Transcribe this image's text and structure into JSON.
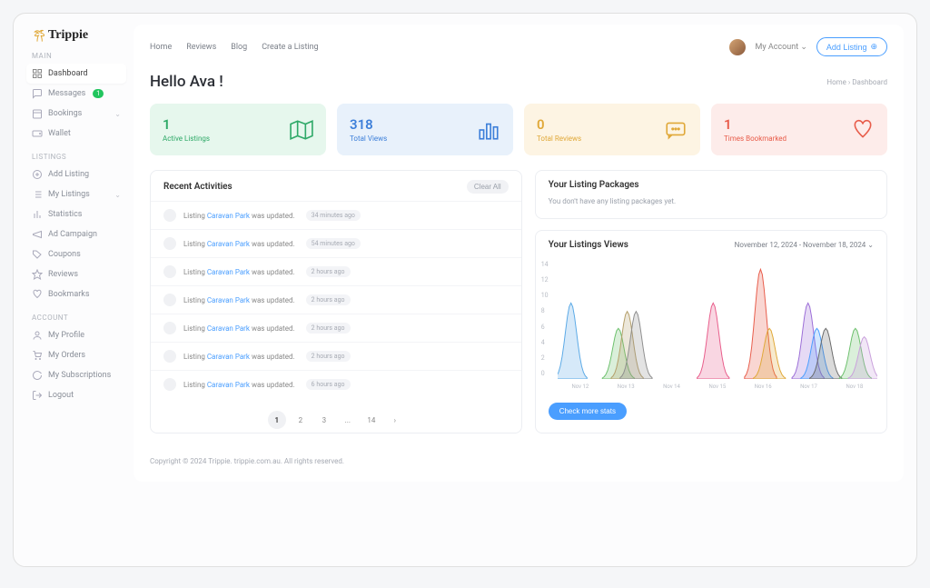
{
  "brand": "Trippie",
  "topnav": {
    "home": "Home",
    "reviews": "Reviews",
    "blog": "Blog",
    "create": "Create a Listing"
  },
  "account": {
    "label": "My Account"
  },
  "add_listing": "Add Listing",
  "sidebar": {
    "section_main": "MAIN",
    "section_listings": "LISTINGS",
    "section_account": "ACCOUNT",
    "dashboard": "Dashboard",
    "messages": "Messages",
    "messages_badge": "1",
    "bookings": "Bookings",
    "wallet": "Wallet",
    "add_listing": "Add Listing",
    "my_listings": "My Listings",
    "statistics": "Statistics",
    "ad_campaign": "Ad Campaign",
    "coupons": "Coupons",
    "reviews": "Reviews",
    "bookmarks": "Bookmarks",
    "my_profile": "My Profile",
    "my_orders": "My Orders",
    "my_subscriptions": "My Subscriptions",
    "logout": "Logout"
  },
  "page": {
    "title": "Hello Ava !",
    "crumb_home": "Home",
    "crumb_current": "Dashboard"
  },
  "stats": {
    "active_num": "1",
    "active_label": "Active Listings",
    "views_num": "318",
    "views_label": "Total Views",
    "reviews_num": "0",
    "reviews_label": "Total Reviews",
    "bookmarked_num": "1",
    "bookmarked_label": "Times Bookmarked"
  },
  "activities": {
    "title": "Recent Activities",
    "clear": "Clear All",
    "prefix": "Listing",
    "link": "Caravan Park",
    "suffix": "was updated.",
    "times": [
      "34 minutes ago",
      "54 minutes ago",
      "2 hours ago",
      "2 hours ago",
      "2 hours ago",
      "2 hours ago",
      "6 hours ago"
    ]
  },
  "pagination": {
    "p1": "1",
    "p2": "2",
    "p3": "3",
    "dots": "...",
    "last": "14"
  },
  "packages": {
    "title": "Your Listing Packages",
    "empty": "You don't have any listing packages yet."
  },
  "chart": {
    "title": "Your Listings Views",
    "range": "November 12, 2024 - November 18, 2024",
    "check": "Check more stats"
  },
  "chart_data": {
    "type": "area",
    "xlabel": "",
    "ylabel": "",
    "ylim": [
      0,
      14
    ],
    "y_ticks": [
      14,
      12,
      10,
      8,
      6,
      4,
      2,
      0
    ],
    "categories": [
      "Nov 12",
      "Nov 13",
      "Nov 14",
      "Nov 15",
      "Nov 16",
      "Nov 17",
      "Nov 18"
    ],
    "note": "Multiple overlapping bell-shaped series; approximate peak heights read from gridlines.",
    "series": [
      {
        "name": "s1",
        "color": "#5aa9e6",
        "peak_day": "Nov 12",
        "peak": 9
      },
      {
        "name": "s2",
        "color": "#6cc06c",
        "peak_day": "Nov 13",
        "peak": 6
      },
      {
        "name": "s3",
        "color": "#b59f6a",
        "peak_day": "Nov 13",
        "peak": 8
      },
      {
        "name": "s4",
        "color": "#8e8e8e",
        "peak_day": "Nov 13",
        "peak": 8
      },
      {
        "name": "s5",
        "color": "#e85c8a",
        "peak_day": "Nov 15",
        "peak": 9
      },
      {
        "name": "s6",
        "color": "#e85c4a",
        "peak_day": "Nov 16",
        "peak": 13
      },
      {
        "name": "s7",
        "color": "#e0a838",
        "peak_day": "Nov 16",
        "peak": 6
      },
      {
        "name": "s8",
        "color": "#9b6dd7",
        "peak_day": "Nov 17",
        "peak": 9
      },
      {
        "name": "s9",
        "color": "#4a9eff",
        "peak_day": "Nov 17",
        "peak": 6
      },
      {
        "name": "s10",
        "color": "#6a6a6a",
        "peak_day": "Nov 17",
        "peak": 6
      },
      {
        "name": "s11",
        "color": "#6cc06c",
        "peak_day": "Nov 18",
        "peak": 6
      },
      {
        "name": "s12",
        "color": "#c9a0dc",
        "peak_day": "Nov 18",
        "peak": 5
      }
    ]
  },
  "footer": "Copyright © 2024 Trippie. trippie.com.au. All rights reserved."
}
